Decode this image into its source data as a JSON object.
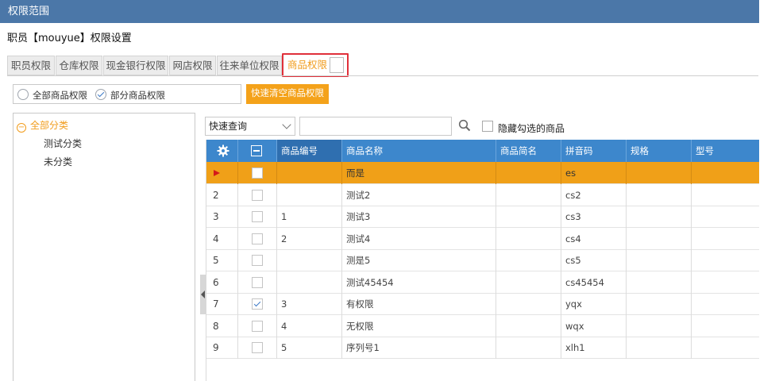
{
  "window": {
    "title": "权限范围"
  },
  "page": {
    "subtitle": "职员【mouyue】权限设置"
  },
  "tabs": [
    {
      "label": "职员权限",
      "active": false
    },
    {
      "label": "仓库权限",
      "active": false
    },
    {
      "label": "现金银行权限",
      "active": false
    },
    {
      "label": "网店权限",
      "active": false
    },
    {
      "label": "往来单位权限",
      "active": false
    },
    {
      "label": "商品权限",
      "active": true
    }
  ],
  "scope": {
    "all_label": "全部商品权限",
    "partial_label": "部分商品权限",
    "selected": "partial",
    "clear_button": "快速清空商品权限"
  },
  "tree": {
    "root": "全部分类",
    "children": [
      "测试分类",
      "未分类"
    ]
  },
  "search": {
    "mode_value": "快速查询",
    "query_value": "",
    "hide_checked_label": "隐藏勾选的商品",
    "hide_checked": false
  },
  "grid": {
    "columns": [
      "商品编号",
      "商品名称",
      "商品简名",
      "拼音码",
      "规格",
      "型号"
    ],
    "rows": [
      {
        "index": "",
        "checked": false,
        "code": "",
        "name": "而是",
        "short": "",
        "pinyin": "es",
        "spec": "",
        "model": "",
        "selected": true
      },
      {
        "index": "2",
        "checked": false,
        "code": "",
        "name": "测试2",
        "short": "",
        "pinyin": "cs2",
        "spec": "",
        "model": ""
      },
      {
        "index": "3",
        "checked": false,
        "code": "1",
        "name": "测试3",
        "short": "",
        "pinyin": "cs3",
        "spec": "",
        "model": ""
      },
      {
        "index": "4",
        "checked": false,
        "code": "2",
        "name": "测试4",
        "short": "",
        "pinyin": "cs4",
        "spec": "",
        "model": ""
      },
      {
        "index": "5",
        "checked": false,
        "code": "",
        "name": "测是5",
        "short": "",
        "pinyin": "cs5",
        "spec": "",
        "model": ""
      },
      {
        "index": "6",
        "checked": false,
        "code": "",
        "name": "测试45454",
        "short": "",
        "pinyin": "cs45454",
        "spec": "",
        "model": ""
      },
      {
        "index": "7",
        "checked": true,
        "code": "3",
        "name": "有权限",
        "short": "",
        "pinyin": "yqx",
        "spec": "",
        "model": ""
      },
      {
        "index": "8",
        "checked": false,
        "code": "4",
        "name": "无权限",
        "short": "",
        "pinyin": "wqx",
        "spec": "",
        "model": ""
      },
      {
        "index": "9",
        "checked": false,
        "code": "5",
        "name": "序列号1",
        "short": "",
        "pinyin": "xlh1",
        "spec": "",
        "model": ""
      }
    ]
  },
  "colors": {
    "title_bar": "#4b77a8",
    "accent_orange": "#f19c1c",
    "grid_header": "#3d87cc",
    "selected_row": "#f0a018",
    "highlight_border": "#e0303a"
  }
}
